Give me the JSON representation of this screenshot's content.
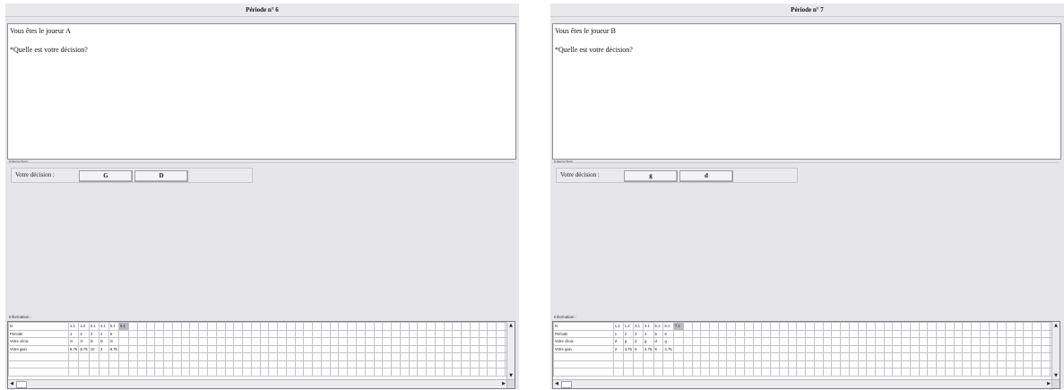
{
  "panels": [
    {
      "title": "Période n° 6",
      "message_line1": "Vous êtes le joueur A",
      "message_line2": "*Quelle est votre décision?",
      "interaction_label": "Interaction",
      "decision_label": "Votre décision :",
      "buttons": [
        "G",
        "D"
      ],
      "info_label": "Information :",
      "table": {
        "rows": [
          {
            "label": "N",
            "cells": [
              "1.1",
              "1.2",
              "3.1",
              "4.1",
              "5.1",
              "6.1"
            ]
          },
          {
            "label": "Période",
            "cells": [
              "1",
              "2",
              "3",
              "4",
              "5",
              ""
            ]
          },
          {
            "label": "Votre choix",
            "cells": [
              "G",
              "G",
              "D",
              "D",
              "G",
              ""
            ]
          },
          {
            "label": "Votre gain",
            "cells": [
              "8.75",
              "8.75",
              "10",
              "3",
              "8.75",
              ""
            ]
          }
        ],
        "selected_column": 5
      }
    },
    {
      "title": "Période n° 7",
      "message_line1": "Vous êtes le joueur B",
      "message_line2": "*Quelle est votre décision?",
      "interaction_label": "Interaction",
      "decision_label": "Votre décision :",
      "buttons": [
        "g",
        "d"
      ],
      "info_label": "Information :",
      "table": {
        "rows": [
          {
            "label": "N",
            "cells": [
              "1.1",
              "1.2",
              "3.1",
              "4.1",
              "5.1",
              "6.1",
              "7.1"
            ]
          },
          {
            "label": "Période",
            "cells": [
              "1",
              "2",
              "3",
              "4",
              "5",
              "6",
              ""
            ]
          },
          {
            "label": "Votre choix",
            "cells": [
              "d",
              "g",
              "d",
              "g",
              "d",
              "g",
              ""
            ]
          },
          {
            "label": "Votre gain",
            "cells": [
              "3",
              "4.75",
              "5",
              "4.75",
              "5",
              "4.75",
              ""
            ]
          }
        ],
        "selected_column": 6
      }
    }
  ]
}
